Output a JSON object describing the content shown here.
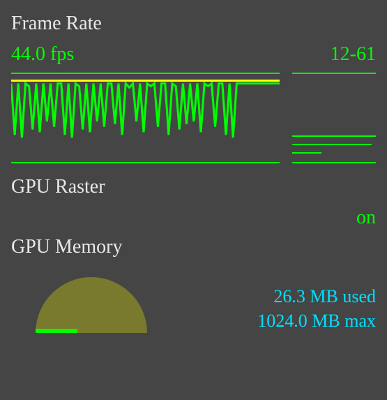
{
  "frame_rate": {
    "title": "Frame Rate",
    "fps_label": "44.0 fps",
    "range_label": "12-61"
  },
  "gpu_raster": {
    "title": "GPU Raster",
    "value": "on"
  },
  "gpu_memory": {
    "title": "GPU Memory",
    "used_label": "26.3 MB used",
    "max_label": "1024.0 MB max"
  },
  "chart_data": {
    "type": "line",
    "title": "Frame Rate",
    "ylabel": "fps",
    "ylim": [
      0,
      65
    ],
    "target_line": 60,
    "series": [
      {
        "name": "fps",
        "values": [
          58,
          20,
          58,
          18,
          58,
          56,
          24,
          58,
          22,
          58,
          30,
          58,
          26,
          58,
          58,
          20,
          58,
          18,
          58,
          56,
          24,
          58,
          22,
          58,
          30,
          58,
          26,
          58,
          58,
          28,
          58,
          20,
          58,
          55,
          58,
          30,
          58,
          22,
          58,
          56,
          58,
          26,
          58,
          58,
          20,
          58,
          56,
          24,
          58,
          28,
          58,
          30,
          58,
          22,
          58,
          56,
          58,
          26,
          58,
          58,
          20,
          58,
          18,
          58,
          58,
          58,
          58,
          58,
          58,
          58,
          58,
          58,
          58,
          58,
          58,
          58
        ]
      }
    ],
    "side_bars": [
      1.0,
      0.95,
      0.35
    ]
  }
}
